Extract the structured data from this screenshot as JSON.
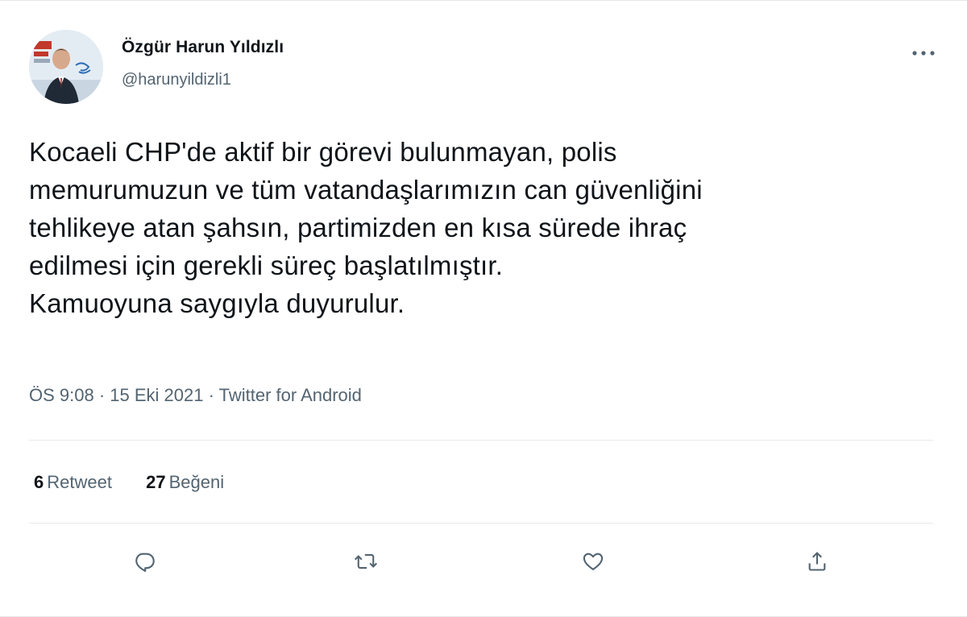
{
  "author": {
    "display_name": "Özgür Harun Yıldızlı",
    "handle": "@harunyildizli1"
  },
  "tweet": {
    "lines": [
      "Kocaeli CHP'de aktif bir görevi bulunmayan, polis",
      "memurumuzun ve tüm vatandaşlarımızın can güvenliğini",
      "tehlikeye atan şahsın, partimizden en kısa sürede ihraç",
      "edilmesi için gerekli süreç başlatılmıştır.",
      "Kamuoyuna saygıyla duyurulur."
    ],
    "meta": "ÖS 9:08 · 15 Eki 2021 · Twitter for Android"
  },
  "stats": {
    "retweets": {
      "count": "6",
      "label": "Retweet"
    },
    "likes": {
      "count": "27",
      "label": "Beğeni"
    }
  },
  "icons": {
    "more": "more-horizontal-icon",
    "reply": "reply-icon",
    "retweet": "retweet-icon",
    "like": "heart-icon",
    "share": "share-icon"
  },
  "colors": {
    "text_primary": "#0f1419",
    "text_secondary": "#536471",
    "divider": "#e6e9ec"
  }
}
